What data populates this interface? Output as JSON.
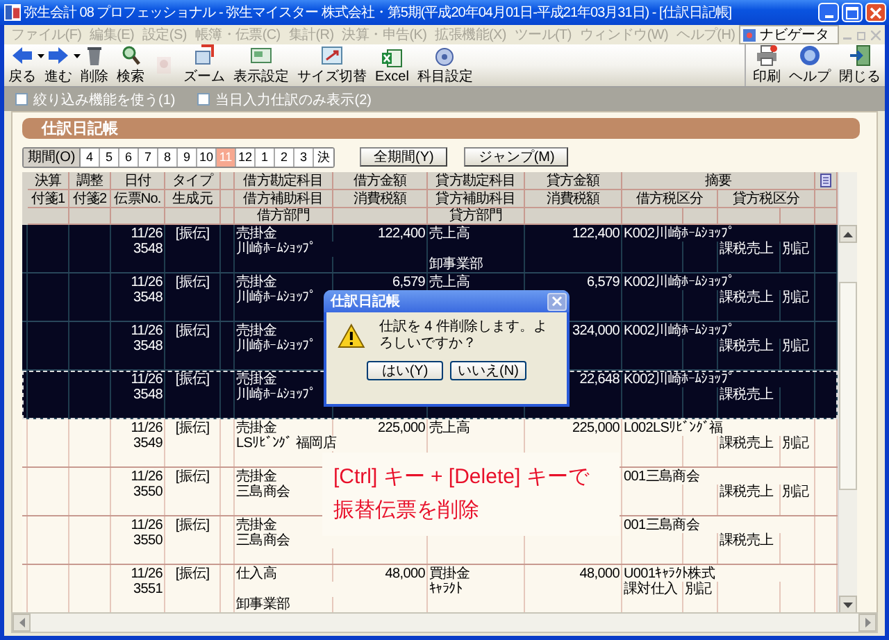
{
  "window": {
    "title": "弥生会計 08 プロフェッショナル - 弥生マイスター 株式会社・第5期(平成20年04月01日-平成21年03月31日) - [仕訳日記帳]"
  },
  "menu": [
    {
      "label": "ファイル(F)",
      "disabled": true
    },
    {
      "label": "編集(E)",
      "disabled": true
    },
    {
      "label": "設定(S)",
      "disabled": true
    },
    {
      "label": "帳簿・伝票(C)",
      "disabled": true
    },
    {
      "label": "集計(R)",
      "disabled": true
    },
    {
      "label": "決算・申告(K)",
      "disabled": true
    },
    {
      "label": "拡張機能(X)",
      "disabled": true
    },
    {
      "label": "ツール(T)",
      "disabled": true
    },
    {
      "label": "ウィンドウ(W)",
      "disabled": true
    },
    {
      "label": "ヘルプ(H)",
      "disabled": true
    }
  ],
  "navigator": {
    "label": "ナビゲータ"
  },
  "toolbar": [
    {
      "label": "戻る",
      "dropdown": true,
      "disabled": false
    },
    {
      "label": "進む",
      "dropdown": true,
      "disabled": false
    },
    {
      "label": "削除",
      "dropdown": false,
      "disabled": false
    },
    {
      "label": "検索",
      "dropdown": false,
      "disabled": false
    },
    {
      "dropdown": false,
      "disabled": true
    },
    {
      "label": "ズーム",
      "dropdown": false,
      "disabled": false
    },
    {
      "label": "表示設定",
      "dropdown": false,
      "disabled": false
    },
    {
      "label": "サイズ切替",
      "dropdown": false,
      "disabled": false
    },
    {
      "label": "Excel",
      "dropdown": false,
      "disabled": false
    },
    {
      "label": "科目設定",
      "dropdown": false,
      "disabled": false
    }
  ],
  "toolbar_right": [
    {
      "label": "印刷"
    },
    {
      "label": "ヘルプ"
    },
    {
      "label": "閉じる"
    }
  ],
  "options": [
    {
      "label": "絞り込み機能を使う(1)",
      "checked": false
    },
    {
      "label": "当日入力仕訳のみ表示(2)",
      "checked": false
    }
  ],
  "panel": {
    "title": "仕訳日記帳"
  },
  "period_label": "期間(O)",
  "periods": [
    {
      "label": "4",
      "selected": false
    },
    {
      "label": "5",
      "selected": false
    },
    {
      "label": "6",
      "selected": false
    },
    {
      "label": "7",
      "selected": false
    },
    {
      "label": "8",
      "selected": false
    },
    {
      "label": "9",
      "selected": false
    },
    {
      "label": "10",
      "selected": false
    },
    {
      "label": "11",
      "selected": true
    },
    {
      "label": "12",
      "selected": false
    },
    {
      "label": "1",
      "selected": false
    },
    {
      "label": "2",
      "selected": false
    },
    {
      "label": "3",
      "selected": false
    },
    {
      "label": "決",
      "selected": false
    }
  ],
  "period_buttons": [
    "全期間(Y)",
    "ジャンプ(M)"
  ],
  "header_rows": [
    [
      "決算",
      "調整",
      "日付",
      "タイプ",
      "借方勘定科目",
      "借方金額",
      "貸方勘定科目",
      "貸方金額",
      "摘要"
    ],
    [
      "付箋1",
      "付箋2",
      "伝票No.",
      "生成元",
      "借方補助科目",
      "消費税額",
      "貸方補助科目",
      "消費税額",
      "借方税区分",
      "貸方税区分"
    ],
    [
      "借方部門",
      "貸方部門"
    ]
  ],
  "entries": [
    {
      "selected": true,
      "focused": false,
      "date": "11/26",
      "type": "[振伝]",
      "no": "3548",
      "debit_account": "売掛金",
      "debit_amount": "122,400",
      "credit_account": "売上高",
      "credit_amount": "122,400",
      "memo": "K002川崎ﾎｰﾑｼｮｯﾌﾟ",
      "debit_sub": "川崎ﾎｰﾑｼｮｯﾌﾟ",
      "credit_tax_class": "課税売上",
      "credit_tax_note": "別記",
      "credit_dept": "卸事業部"
    },
    {
      "selected": true,
      "focused": false,
      "date": "11/26",
      "type": "[振伝]",
      "no": "3548",
      "debit_account": "売掛金",
      "debit_amount": "6,579",
      "credit_account": "売上高",
      "credit_amount": "6,579",
      "memo": "K002川崎ﾎｰﾑｼｮｯﾌﾟ",
      "debit_sub": "川崎ﾎｰﾑｼｮｯﾌﾟ",
      "credit_tax_class": "課税売上",
      "credit_tax_note": "別記"
    },
    {
      "selected": true,
      "focused": false,
      "date": "11/26",
      "type": "[振伝]",
      "no": "3548",
      "debit_account": "売掛金",
      "credit_amount": "324,000",
      "memo": "K002川崎ﾎｰﾑｼｮｯﾌﾟ",
      "debit_sub": "川崎ﾎｰﾑｼｮｯﾌﾟ",
      "credit_tax_class": "課税売上",
      "credit_tax_note": "別記"
    },
    {
      "selected": true,
      "focused": true,
      "date": "11/26",
      "type": "[振伝]",
      "no": "3548",
      "debit_account": "売掛金",
      "credit_amount": "22,648",
      "memo": "K002川崎ﾎｰﾑｼｮｯﾌﾟ",
      "debit_sub": "川崎ﾎｰﾑｼｮｯﾌﾟ",
      "credit_tax_class": "課税売上"
    },
    {
      "selected": false,
      "focused": false,
      "date": "11/26",
      "type": "[振伝]",
      "no": "3549",
      "debit_account": "売掛金",
      "debit_amount": "225,000",
      "credit_account": "売上高",
      "credit_amount": "225,000",
      "memo": "L002LSﾘﾋﾞﾝｸﾞ福",
      "debit_sub": "LSﾘﾋﾞﾝｸﾞ 福岡店",
      "credit_tax_class": "課税売上",
      "credit_tax_note": "別記"
    },
    {
      "selected": false,
      "focused": false,
      "date": "11/26",
      "type": "[振伝]",
      "no": "3550",
      "debit_account": "売掛金",
      "memo": "001三島商会",
      "debit_sub": "三島商会",
      "credit_tax_class": "課税売上",
      "credit_tax_note": "別記"
    },
    {
      "selected": false,
      "focused": false,
      "date": "11/26",
      "type": "[振伝]",
      "no": "3550",
      "debit_account": "売掛金",
      "memo": "001三島商会",
      "debit_sub": "三島商会",
      "credit_tax_class": "課税売上"
    },
    {
      "selected": false,
      "focused": false,
      "date": "11/26",
      "type": "[振伝]",
      "no": "3551",
      "debit_account": "仕入高",
      "debit_amount": "48,000",
      "credit_account": "買掛金",
      "credit_amount": "48,000",
      "memo": "U001ｷｬﾗｸﾄ株式",
      "credit_sub": "ｷｬﾗｸﾄ",
      "debit_tax_class": "課対仕入",
      "debit_tax_note": "別記",
      "debit_dept": "卸事業部"
    }
  ],
  "dialog": {
    "title": "仕訳日記帳",
    "message": "仕訳を 4 件削除します。よろしいですか？",
    "buttons": [
      "はい(Y)",
      "いいえ(N)"
    ]
  },
  "annotation": {
    "lines": [
      "[Ctrl] キー + [Delete] キーで",
      "振替伝票を削除"
    ]
  }
}
